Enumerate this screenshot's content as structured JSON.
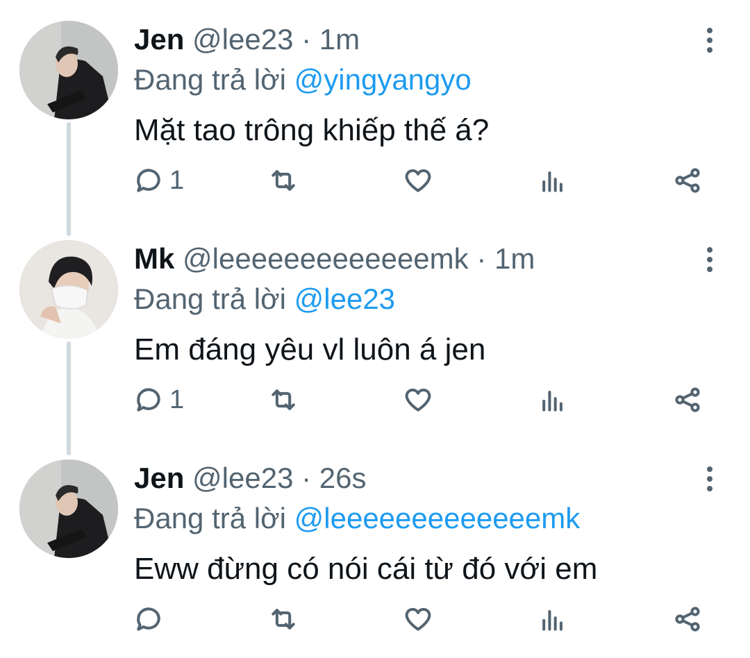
{
  "tweets": [
    {
      "name": "Jen",
      "handle": "@lee23",
      "sep": "·",
      "time": "1m",
      "replying_prefix": "Đang trả lời",
      "replying_to": "@yingyangyo",
      "text": "Mặt tao trông khiếp thế á?",
      "reply_count": "1"
    },
    {
      "name": "Mk",
      "handle": "@leeeeeeeeeeeeemk",
      "sep": "·",
      "time": "1m",
      "replying_prefix": "Đang trả lời",
      "replying_to": "@lee23",
      "text": "Em đáng yêu vl luôn á jen",
      "reply_count": "1"
    },
    {
      "name": "Jen",
      "handle": "@lee23",
      "sep": "·",
      "time": "26s",
      "replying_prefix": "Đang trả lời",
      "replying_to": "@leeeeeeeeeeeeemk",
      "text": "Eww đừng có nói cái từ đó với em",
      "reply_count": ""
    }
  ],
  "icons": [
    "reply-icon",
    "retweet-icon",
    "like-icon",
    "views-icon",
    "share-icon",
    "more-icon"
  ],
  "colors": {
    "accent": "#1d9bf0",
    "muted": "#536471",
    "text": "#0f1419",
    "thread_line": "#cfd9de"
  }
}
